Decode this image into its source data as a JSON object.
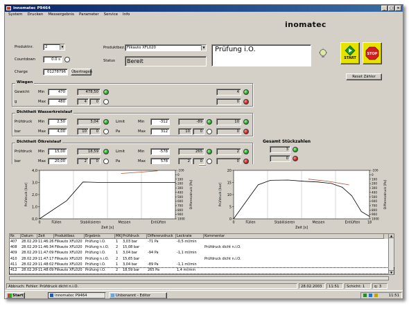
{
  "window": {
    "title": "innomatec P9464"
  },
  "menu": [
    "System",
    "Drucken",
    "Messergebnis",
    "Parameter",
    "Service",
    "Info"
  ],
  "brand": {
    "logo_text": "inomatec"
  },
  "controls": {
    "produktnr_label": "Produktnr.",
    "produktnr_value": "2",
    "countdown_label": "Countdown",
    "countdown_value": "0.0 s",
    "charge_label": "Charge",
    "charge_value": "01278796",
    "uebertragen_button": "Übertragen",
    "produktbez_label": "Produktbez.",
    "produktbez_value": "Filkauto XFL020",
    "status_label": "Status",
    "status_value": "Bereit",
    "result_text": "Prüfung i.O.",
    "start_label": "START",
    "stop_label": "STOP",
    "reset_button": "Reset Zähler"
  },
  "wiegen": {
    "title": "Wiegen",
    "r1": {
      "label": "Gewicht",
      "sub": "Min",
      "limit": "470",
      "value": "478,50"
    },
    "r2": {
      "label": "g",
      "sub": "Max",
      "limit": "480",
      "count_a": "4",
      "count_b": "0"
    },
    "cnt_ok": "4",
    "cnt_nok": "0"
  },
  "wasser": {
    "title": "Dichtheit Wasserkreislauf",
    "r1": {
      "label": "Prüfdruck",
      "sub": "Min",
      "limit": "2,50",
      "value": "3,04"
    },
    "r2": {
      "label": "bar",
      "sub": "Max",
      "limit": "4,00",
      "count_a": "10",
      "count_b": "0"
    },
    "leak": {
      "limit_label": "Limit",
      "pa_label": "Pa",
      "min_label": "Min",
      "max_label": "Max",
      "min": "-312",
      "max": "312",
      "value": "-89",
      "count_a": "10",
      "count_b": "0"
    },
    "cnt_ok": "10",
    "cnt_nok": "0"
  },
  "oel": {
    "title": "Dichtheit Ölkreislauf",
    "r1": {
      "label": "Prüfdruck",
      "sub": "Min",
      "limit": "15,00",
      "value": "18,59"
    },
    "r2": {
      "label": "bar",
      "sub": "Max",
      "limit": "20,00",
      "count_a": "2",
      "count_b": "0"
    },
    "leak": {
      "limit_label": "Limit",
      "pa_label": "Pa",
      "min_label": "Min",
      "max_label": "Max",
      "min": "-578",
      "max": "578",
      "value": "265",
      "count_a": "2",
      "count_b": "0"
    },
    "cnt_ok": "2",
    "cnt_nok": "0"
  },
  "gesamt": {
    "title": "Gesamt Stückzahlen",
    "ok": "3",
    "nok": "0"
  },
  "chart_data": [
    {
      "type": "line",
      "xlabel": "Zeit [s]",
      "ylabel_left": "Prüfdruck [bar]",
      "ylabel_right": "Differenzdruck [Pa]",
      "ylim_left": [
        0,
        4
      ],
      "yticks_left": [
        "0,0",
        "1,0",
        "2,0",
        "3,0",
        "4,0"
      ],
      "ylim_right": [
        1000,
        -100
      ],
      "yticks_right": [
        "-100",
        "0",
        "100",
        "200",
        "300",
        "400",
        "500",
        "600",
        "700",
        "800",
        "900",
        "1000"
      ],
      "phases": [
        "Füllen",
        "Stabilisieren",
        "Messen",
        "Entlüften"
      ],
      "xticks": [
        "0"
      ],
      "series": [
        {
          "color": "#000000",
          "x": [
            0,
            0.2,
            0.32,
            0.45,
            0.6,
            0.75,
            0.87,
            0.93,
            1.0
          ],
          "y": [
            0.0,
            1.5,
            3.04,
            3.0,
            3.0,
            3.0,
            3.0,
            3.0,
            3.0
          ]
        },
        {
          "color": "#b05030",
          "x": [
            0.6,
            0.75,
            0.87
          ],
          "y": [
            -30,
            -60,
            -89
          ]
        }
      ]
    },
    {
      "type": "line",
      "xlabel": "Zeit [s]",
      "ylabel_left": "Prüfdruck [bar]",
      "ylabel_right": "Differenzdruck [Pa]",
      "ylim_left": [
        0,
        20
      ],
      "yticks_left": [
        "0",
        "5",
        "10",
        "15",
        "20"
      ],
      "ylim_right": [
        1000,
        -100
      ],
      "yticks_right": [
        "-100",
        "0",
        "100",
        "200",
        "300",
        "400",
        "500",
        "600",
        "700",
        "800",
        "900",
        "1000"
      ],
      "phases": [
        "Füllen",
        "Stabilisieren",
        "Messen",
        "Entlüften"
      ],
      "xticks": [
        "0",
        "18"
      ],
      "series": [
        {
          "color": "#000000",
          "x": [
            0,
            0.18,
            0.27,
            0.4,
            0.52,
            0.62,
            0.72,
            0.8,
            0.87,
            0.94,
            1.0
          ],
          "y": [
            0,
            14,
            15.9,
            16,
            15.5,
            15.2,
            14.6,
            13,
            9.5,
            3,
            1
          ]
        },
        {
          "color": "#b05030",
          "x": [
            0.55,
            0.7,
            0.85
          ],
          "y": [
            100,
            150,
            230
          ]
        }
      ]
    }
  ],
  "table": {
    "columns": [
      "Nr.",
      "Datum",
      "Zeit",
      "Produktbez.",
      "Ergebnis",
      "MK",
      "Prüfdruck",
      "Differenzdruck",
      "Leckrate",
      "Kommentar"
    ],
    "rows": [
      [
        "407",
        "28.02.2003",
        "11:46:26",
        "Filkauto XFL020",
        "Prüfung i.O.",
        "1",
        "3,03 bar",
        "-71 Pa",
        "-0,5 ml/min",
        ""
      ],
      [
        "408",
        "28.02.2003",
        "11:46:34",
        "Filkauto XFL020",
        "Prüfung n.i.O.",
        "2",
        "15,08 bar",
        "",
        "",
        "Prüfdruck dicht n.i.O."
      ],
      [
        "409",
        "28.02.2003",
        "11:47:09",
        "Filkauto XFL020",
        "Prüfung i.O.",
        "1",
        "3,04 bar",
        "-94 Pa",
        "-1,1 ml/min",
        ""
      ],
      [
        "410",
        "28.02.2003",
        "11:47:17",
        "Filkauto XFL020",
        "Prüfung n.i.O.",
        "2",
        "15,65 bar",
        "",
        "",
        "Prüfdruck dicht n.i.O."
      ],
      [
        "411",
        "28.02.2003",
        "11:48:02",
        "Filkauto XFL020",
        "Prüfung i.O.",
        "1",
        "3,04 bar",
        "-89 Pa",
        "-1,1 ml/min",
        ""
      ],
      [
        "412",
        "28.02.2003",
        "11:48:09",
        "Filkauto XFL020",
        "Prüfung i.O.",
        "2",
        "18,59 bar",
        "265 Pa",
        "1,4 ml/min",
        ""
      ]
    ]
  },
  "statusbar": {
    "message": "Abbruch: Fehler: Prüfdruck dicht n.i.O.",
    "date": "28.02.2003",
    "time": "11:51",
    "shift": "Schicht: 1",
    "q": "q: 3"
  },
  "taskbar": {
    "start": "Start",
    "item1": "innomatec P9464",
    "item2": "Unbenannt - Editor",
    "clock": "11:51"
  }
}
